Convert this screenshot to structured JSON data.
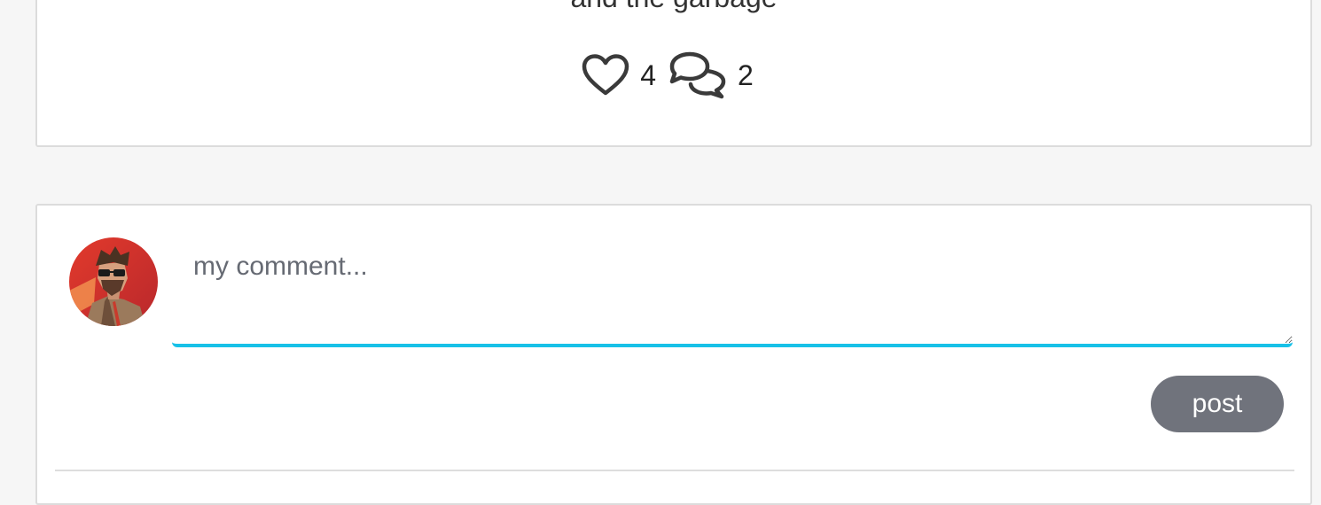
{
  "post": {
    "text_fragment": "and the garbage",
    "likes_count": "4",
    "comments_count": "2",
    "icons": {
      "like": "heart-outline-icon",
      "comments": "speech-bubbles-icon"
    }
  },
  "composer": {
    "placeholder": "my comment...",
    "value": "",
    "post_label": "post",
    "accent_color": "#17c1e8",
    "button_color": "#70737c"
  }
}
